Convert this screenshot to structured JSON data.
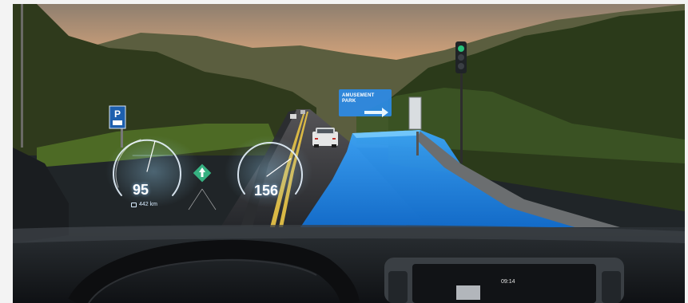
{
  "hud": {
    "left_gauge_value": "95",
    "right_gauge_value": "156",
    "range_text": "442 km",
    "accent_color": "#6cc6ff"
  },
  "billboard": {
    "line1": "AMUSEMENT",
    "line2": "PARK"
  },
  "dashboard": {
    "clock": "09:14"
  },
  "icons": [
    "parking-sign-icon",
    "traffic-light-icon",
    "fuel-icon",
    "navigation-arrow-icon",
    "route-arrow-icon"
  ]
}
